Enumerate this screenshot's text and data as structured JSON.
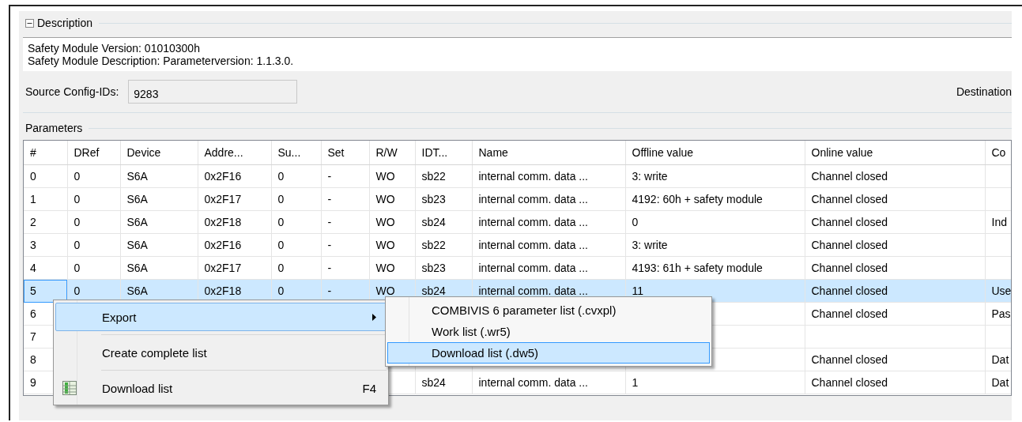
{
  "description": {
    "title": "Description",
    "expanded": true,
    "lines": [
      "Safety Module Version: 01010300h",
      "Safety Module Description: Parameterversion: 1.1.3.0."
    ]
  },
  "source_config_ids": {
    "label": "Source Config-IDs:",
    "value": "9283"
  },
  "destination_label": "Destination",
  "parameters": {
    "title": "Parameters",
    "columns": [
      "#",
      "DRef",
      "Device",
      "Addre...",
      "Su...",
      "Set",
      "R/W",
      "IDT...",
      "Name",
      "Offline value",
      "Online value",
      "Co"
    ],
    "rows": [
      {
        "selected": false,
        "cells": [
          "0",
          "0",
          "S6A",
          "0x2F16",
          "0",
          "-",
          "WO",
          "sb22",
          "internal comm. data ...",
          "3: write",
          "Channel closed",
          null
        ]
      },
      {
        "selected": false,
        "cells": [
          "1",
          "0",
          "S6A",
          "0x2F17",
          "0",
          "-",
          "WO",
          "sb23",
          "internal comm. data ...",
          "4192: 60h + safety module",
          "Channel closed",
          null
        ]
      },
      {
        "selected": false,
        "cells": [
          "2",
          "0",
          "S6A",
          "0x2F18",
          "0",
          "-",
          "WO",
          "sb24",
          "internal comm. data ...",
          "0",
          "Channel closed",
          "Ind"
        ]
      },
      {
        "selected": false,
        "cells": [
          "3",
          "0",
          "S6A",
          "0x2F16",
          "0",
          "-",
          "WO",
          "sb22",
          "internal comm. data ...",
          "3: write",
          "Channel closed",
          null
        ]
      },
      {
        "selected": false,
        "cells": [
          "4",
          "0",
          "S6A",
          "0x2F17",
          "0",
          "-",
          "WO",
          "sb23",
          "internal comm. data ...",
          "4193: 61h + safety module",
          "Channel closed",
          null
        ]
      },
      {
        "selected": true,
        "cells": [
          "5",
          "0",
          "S6A",
          "0x2F18",
          "0",
          "-",
          "WO",
          "sb24",
          "internal comm. data ...",
          "11",
          "Channel closed",
          "Use"
        ]
      },
      {
        "selected": false,
        "cells": [
          "6",
          null,
          null,
          null,
          null,
          null,
          null,
          null,
          null,
          null,
          "Channel closed",
          "Pas"
        ]
      },
      {
        "selected": false,
        "cells": [
          "7",
          null,
          null,
          null,
          null,
          null,
          null,
          null,
          null,
          null,
          null,
          null
        ]
      },
      {
        "selected": false,
        "cells": [
          "8",
          null,
          null,
          null,
          null,
          null,
          null,
          null,
          null,
          null,
          "Channel closed",
          "Dat"
        ]
      },
      {
        "selected": false,
        "cells": [
          "9",
          null,
          null,
          null,
          null,
          null,
          null,
          "sb24",
          "internal comm. data ...",
          "1",
          "Channel closed",
          "Dat"
        ]
      }
    ]
  },
  "context_menu": {
    "items": [
      {
        "kind": "submenu",
        "label": "Export",
        "selected": true
      },
      {
        "kind": "plain",
        "label": "Create complete list",
        "selected": false
      },
      {
        "kind": "command",
        "label": "Download list",
        "shortcut": "F4",
        "selected": false
      }
    ]
  },
  "submenu": {
    "items": [
      {
        "label": "COMBIVIS 6 parameter list (.cvxpl)",
        "selected": false
      },
      {
        "label": "Work list (.wr5)",
        "selected": false
      },
      {
        "label": "Download list (.dw5)",
        "selected": true
      }
    ]
  }
}
